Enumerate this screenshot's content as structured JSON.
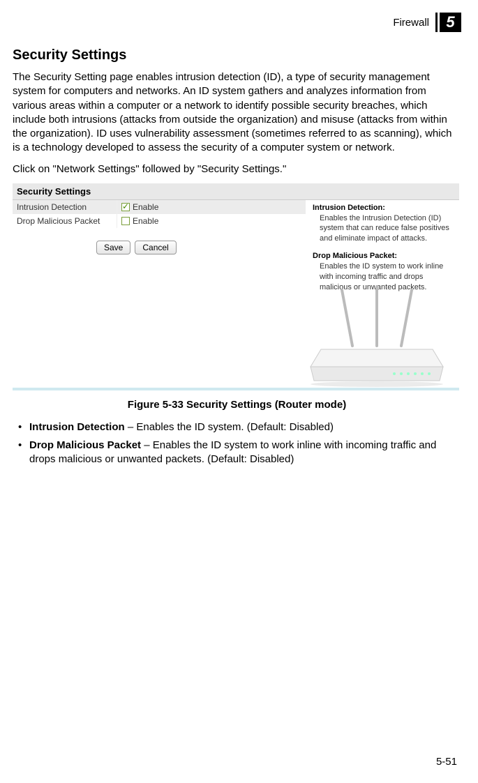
{
  "header": {
    "section": "Firewall",
    "chapter": "5"
  },
  "title": "Security Settings",
  "para1": "The Security Setting page enables intrusion detection (ID), a type of security management system for computers and networks. An ID system gathers and analyzes information from various areas within a computer or a network to identify possible security breaches, which include both intrusions (attacks from outside the organization) and misuse (attacks from within the organization). ID uses vulnerability assessment (sometimes referred to as scanning), which is a technology developed to assess the security of a computer system or network.",
  "para2": "Click on \"Network Settings\" followed by \"Security Settings.\"",
  "panel": {
    "title": "Security Settings",
    "rows": [
      {
        "label": "Intrusion Detection",
        "control": "Enable",
        "checked": true
      },
      {
        "label": "Drop Malicious Packet",
        "control": "Enable",
        "checked": false
      }
    ],
    "help": {
      "h1_title": "Intrusion Detection:",
      "h1_body": "Enables the Intrusion Detection (ID) system that can reduce false positives and eliminate impact of attacks.",
      "h2_title": "Drop Malicious Packet:",
      "h2_body": "Enables the ID system to work inline with incoming traffic and drops malicious or unwanted packets."
    },
    "buttons": {
      "save": "Save",
      "cancel": "Cancel"
    }
  },
  "figure_caption": "Figure 5-33  Security Settings (Router mode)",
  "bullets": {
    "b1_bold": "Intrusion Detection",
    "b1_rest": " – Enables the ID system. (Default: Disabled)",
    "b2_bold": "Drop Malicious Packet",
    "b2_rest": " – Enables the ID system to work inline with incoming traffic and drops malicious or unwanted packets. (Default: Disabled)"
  },
  "page_number": "5-51"
}
